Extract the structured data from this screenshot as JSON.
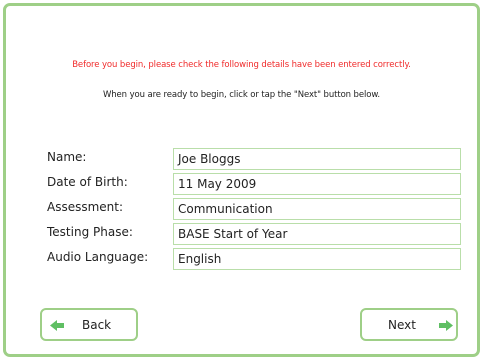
{
  "messages": {
    "warning": "Before you begin, please check the following details have been entered correctly.",
    "instruction": "When you are ready to begin, click or tap the \"Next\" button below."
  },
  "details": [
    {
      "label": "Name:",
      "value": "Joe Bloggs"
    },
    {
      "label": "Date of Birth:",
      "value": "11 May 2009"
    },
    {
      "label": "Assessment:",
      "value": "Communication"
    },
    {
      "label": "Testing Phase:",
      "value": "BASE Start of Year"
    },
    {
      "label": "Audio Language:",
      "value": "English"
    }
  ],
  "buttons": {
    "back_label": "Back",
    "next_label": "Next"
  },
  "colors": {
    "accent": "#9ecf87",
    "arrow": "#5fbf63",
    "warning": "#f02b2b"
  },
  "icons": {
    "back": "arrow-left-icon",
    "next": "arrow-right-icon"
  }
}
